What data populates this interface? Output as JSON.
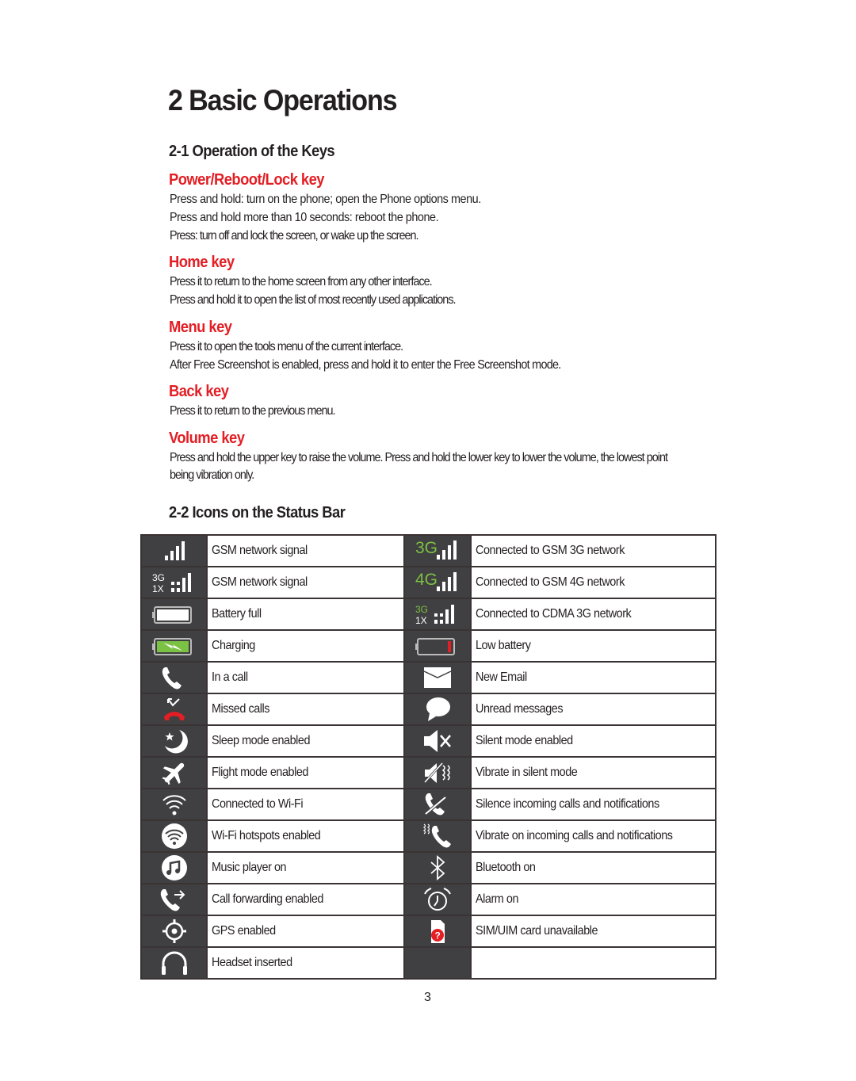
{
  "title": "2 Basic Operations",
  "section_keys": {
    "heading": "2-1 Operation of the Keys",
    "keys": [
      {
        "name": "Power/Reboot/Lock key",
        "lines": [
          "Press and hold: turn on the phone; open the Phone options menu.",
          "Press and hold more than 10 seconds: reboot the phone.",
          "Press: turn off and lock the screen, or wake up the screen."
        ]
      },
      {
        "name": "Home key",
        "lines": [
          "Press it to return to the home screen from any other interface.",
          "Press and hold it to open the list of most recently used applications."
        ]
      },
      {
        "name": "Menu key",
        "lines": [
          "Press it to open the tools menu of the current interface.",
          "After Free Screenshot is enabled, press and hold it to enter the Free Screenshot mode."
        ]
      },
      {
        "name": "Back key",
        "lines": [
          "Press it to return to the previous menu."
        ]
      },
      {
        "name": "Volume key",
        "lines": [
          "Press and hold the upper key to raise the volume. Press and hold the lower key to lower the volume, the lowest point being vibration only."
        ]
      }
    ]
  },
  "section_icons": {
    "heading": "2-2 Icons on the Status Bar",
    "rows": [
      {
        "left": {
          "icon": "signal-bars-icon",
          "label": "GSM network signal"
        },
        "right": {
          "icon": "3g-signal-icon",
          "label": "Connected to GSM 3G network"
        }
      },
      {
        "left": {
          "icon": "3g-1x-signal-icon",
          "label": "GSM network signal"
        },
        "right": {
          "icon": "4g-signal-icon",
          "label": "Connected to GSM 4G network"
        }
      },
      {
        "left": {
          "icon": "battery-full-icon",
          "label": "Battery full"
        },
        "right": {
          "icon": "cdma-3g-1x-signal-icon",
          "label": "Connected to CDMA 3G network"
        }
      },
      {
        "left": {
          "icon": "battery-charging-icon",
          "label": "Charging"
        },
        "right": {
          "icon": "battery-low-icon",
          "label": "Low battery"
        }
      },
      {
        "left": {
          "icon": "phone-call-icon",
          "label": "In a call"
        },
        "right": {
          "icon": "envelope-icon",
          "label": "New Email"
        }
      },
      {
        "left": {
          "icon": "missed-call-icon",
          "label": "Missed calls"
        },
        "right": {
          "icon": "chat-bubble-icon",
          "label": "Unread messages"
        }
      },
      {
        "left": {
          "icon": "moon-star-icon",
          "label": "Sleep mode enabled"
        },
        "right": {
          "icon": "speaker-muted-icon",
          "label": "Silent mode enabled"
        }
      },
      {
        "left": {
          "icon": "airplane-icon",
          "label": "Flight mode enabled"
        },
        "right": {
          "icon": "vibrate-silent-icon",
          "label": "Vibrate in silent mode"
        }
      },
      {
        "left": {
          "icon": "wifi-icon",
          "label": "Connected to Wi-Fi"
        },
        "right": {
          "icon": "phone-silenced-icon",
          "label": "Silence incoming calls and notifications"
        }
      },
      {
        "left": {
          "icon": "wifi-hotspot-icon",
          "label": "Wi-Fi hotspots enabled"
        },
        "right": {
          "icon": "phone-vibrate-icon",
          "label": "Vibrate on incoming calls and notifications"
        }
      },
      {
        "left": {
          "icon": "music-note-icon",
          "label": "Music player on"
        },
        "right": {
          "icon": "bluetooth-icon",
          "label": "Bluetooth on"
        }
      },
      {
        "left": {
          "icon": "call-forward-icon",
          "label": "Call forwarding enabled"
        },
        "right": {
          "icon": "alarm-clock-icon",
          "label": "Alarm on"
        }
      },
      {
        "left": {
          "icon": "gps-crosshair-icon",
          "label": "GPS enabled"
        },
        "right": {
          "icon": "sim-unavailable-icon",
          "label": "SIM/UIM card unavailable"
        }
      },
      {
        "left": {
          "icon": "headset-icon",
          "label": "Headset inserted"
        },
        "right": {
          "icon": "",
          "label": ""
        }
      }
    ]
  },
  "colors": {
    "accent_red": "#e31e24",
    "network_green": "#7bc143",
    "icon_cell_bg": "#403f41",
    "text": "#231f20"
  },
  "page_number": "3"
}
